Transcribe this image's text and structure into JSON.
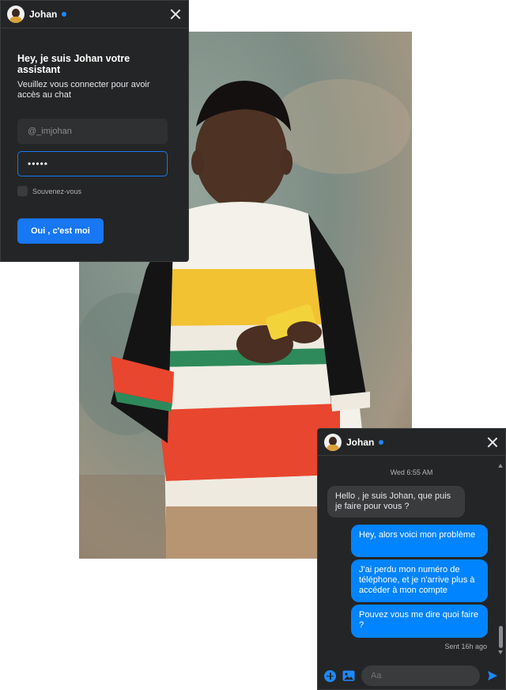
{
  "login_widget": {
    "name": "Johan",
    "title": "Hey, je suis Johan votre assistant",
    "subtitle": "Veuillez vous connecter pour avoir accès au chat",
    "username_value": "@_imjohan",
    "password_value": "•••••",
    "remember_label": "Souvenez-vous",
    "submit_label": "Oui , c'est moi"
  },
  "chat_widget": {
    "name": "Johan",
    "timestamp": "Wed 6:55 AM",
    "messages": [
      {
        "from": "bot",
        "text": "Hello , je suis Johan, que puis je faire pour vous ?"
      },
      {
        "from": "user",
        "text": "Hey, alors voici mon problème"
      },
      {
        "from": "user",
        "text": "J'ai perdu mon numéro de téléphone, et je n'arrive plus à accéder à mon compte"
      },
      {
        "from": "user",
        "text": "Pouvez vous me dire quoi faire ?"
      }
    ],
    "sent_status": "Sent 16h ago",
    "input_placeholder": "Aa"
  },
  "colors": {
    "panel": "#242526",
    "accent": "#1877f2",
    "bubble_out": "#0084ff",
    "bubble_in": "#3a3b3c"
  },
  "icons": [
    "avatar",
    "online-dot-icon",
    "close-icon",
    "plus-icon",
    "image-icon",
    "send-icon"
  ]
}
